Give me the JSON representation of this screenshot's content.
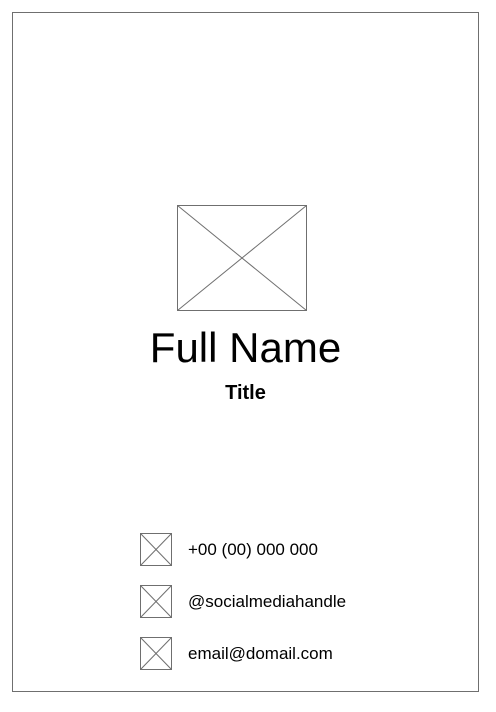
{
  "card": {
    "full_name": "Full Name",
    "title": "Title",
    "photo_icon": "image-placeholder-icon",
    "contacts": [
      {
        "icon": "phone-icon",
        "text": "+00 (00) 000 000"
      },
      {
        "icon": "social-media-icon",
        "text": "@socialmediahandle"
      },
      {
        "icon": "email-icon",
        "text": "email@domail.com"
      }
    ]
  },
  "colors": {
    "border": "#6f6f6f",
    "placeholder_stroke": "#6f6f6f",
    "text": "#000000",
    "background": "#ffffff"
  }
}
